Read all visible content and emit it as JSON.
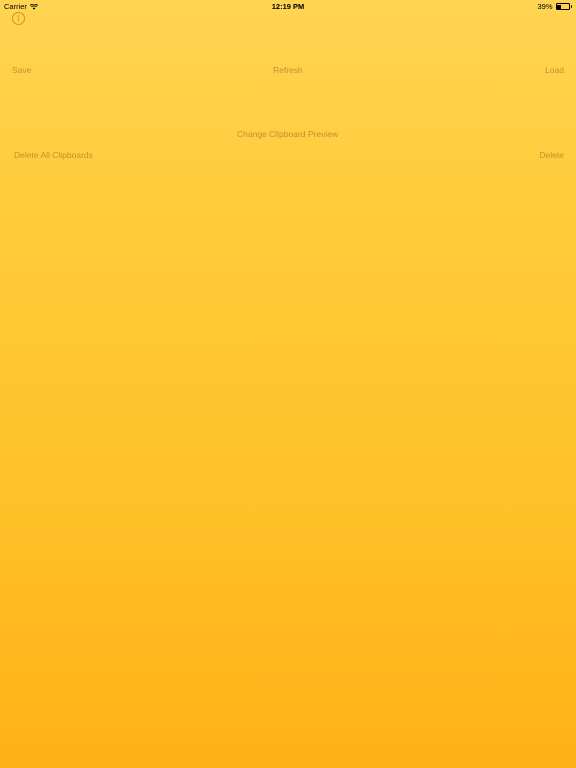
{
  "status_bar": {
    "carrier": "Carrier",
    "time": "12:19 PM",
    "battery_percent_text": "39%",
    "battery_level": 0.39
  },
  "toolbar": {
    "info_icon": "info-circle-icon",
    "save_label": "Save",
    "refresh_label": "Refresh",
    "load_label": "Load"
  },
  "actions": {
    "change_preview_label": "Change Clipboard Preview",
    "delete_all_label": "Delete All Clipboards",
    "delete_label": "Delete"
  },
  "colors": {
    "gradient_top": "#FFD452",
    "gradient_bottom": "#FFB116",
    "button_text": "#C58F2E"
  }
}
